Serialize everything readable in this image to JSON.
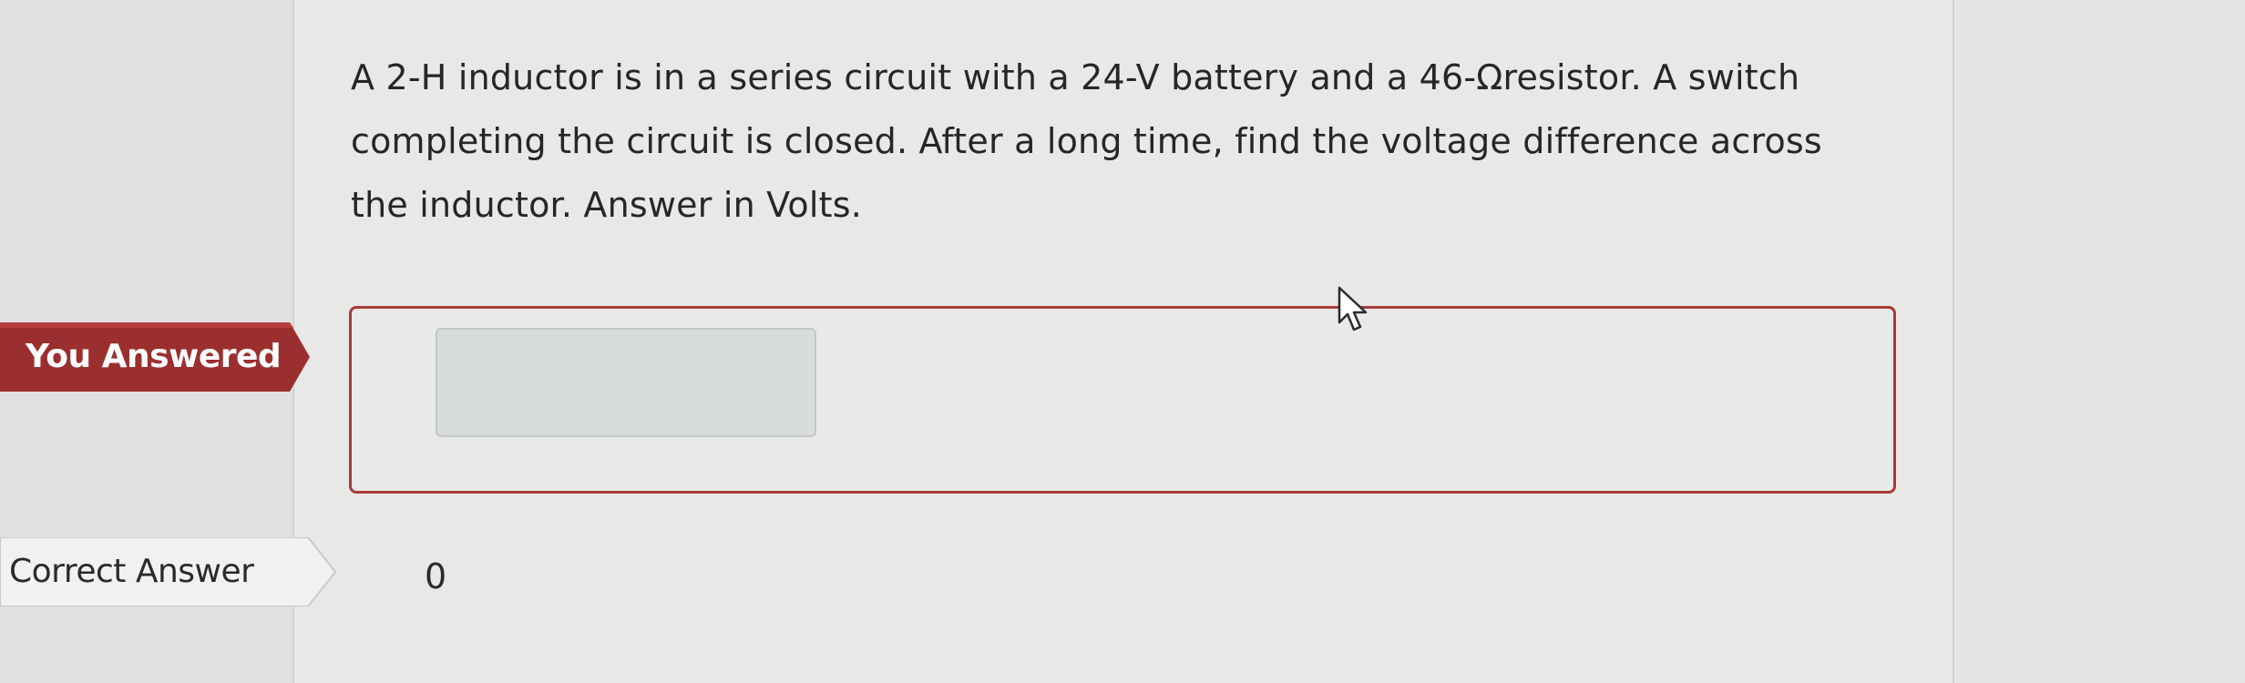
{
  "question": {
    "text": "A 2-H inductor is in a series circuit with a 24-V battery and a 46-Ωresistor. A switch completing the circuit is closed. After a long time, find the voltage difference across the inductor. Answer in Volts."
  },
  "you_answered": {
    "label": "You Answered",
    "value": "",
    "status_color": "#a83a3a"
  },
  "correct_answer": {
    "label": "Correct Answer",
    "value": "0"
  },
  "icons": {
    "cursor": "mouse-pointer-icon"
  }
}
